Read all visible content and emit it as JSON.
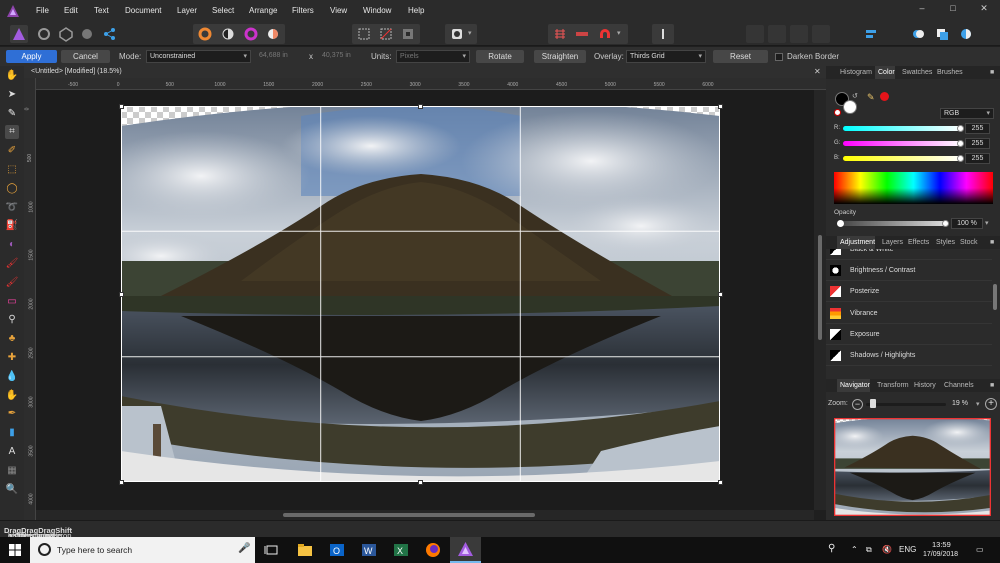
{
  "menu": {
    "items": [
      "File",
      "Edit",
      "Text",
      "Document",
      "Layer",
      "Select",
      "Arrange",
      "Filters",
      "View",
      "Window",
      "Help"
    ],
    "window_controls": {
      "minimize": "–",
      "maximize": "□",
      "close": "✕"
    }
  },
  "context": {
    "apply": "Apply",
    "cancel": "Cancel",
    "mode_label": "Mode:",
    "mode_value": "Unconstrained",
    "width": "64,688 in",
    "x_sep": "x",
    "height": "40,375 in",
    "units_label": "Units:",
    "units_value": "Pixels",
    "rotate": "Rotate",
    "straighten": "Straighten",
    "overlay_label": "Overlay:",
    "overlay_value": "Thirds Grid",
    "reset": "Reset",
    "darken_border": "Darken Border"
  },
  "document": {
    "tab_title": "<Untitled> [Modified] (18.5%)",
    "hruler": [
      "-500",
      "0",
      "500",
      "1000",
      "1500",
      "2000",
      "2500",
      "3000",
      "3500",
      "4000",
      "4500",
      "5000",
      "5500",
      "6000"
    ],
    "vruler": [
      "0",
      "500",
      "1000",
      "1500",
      "2000",
      "2500",
      "3000",
      "3500",
      "4000"
    ]
  },
  "panel_top": {
    "tabs": [
      "Histogram",
      "Color",
      "Swatches",
      "Brushes"
    ],
    "active_tab": "Color",
    "model": "RGB",
    "r_label": "R:",
    "r_value": "255",
    "g_label": "G:",
    "g_value": "255",
    "b_label": "B:",
    "b_value": "255",
    "opacity_label": "Opacity",
    "opacity_value": "100 %",
    "opacity_fraction": 1.0
  },
  "panel_mid": {
    "tabs": [
      "Adjustment",
      "Layers",
      "Effects",
      "Styles",
      "Stock"
    ],
    "active_tab": "Adjustment",
    "items": [
      "Black & White",
      "Brightness / Contrast",
      "Posterize",
      "Vibrance",
      "Exposure",
      "Shadows / Highlights"
    ]
  },
  "panel_nav": {
    "tabs": [
      "Navigator",
      "Transform",
      "History",
      "Channels"
    ],
    "active_tab": "Navigator",
    "zoom_label": "Zoom:",
    "zoom_value": "19 %",
    "zoom_fraction": 0.05
  },
  "status_bar": {
    "parts": [
      {
        "t": "Drag",
        "b": true
      },
      {
        "t": " handles to set crop size. ",
        "b": false
      },
      {
        "t": "Drag",
        "b": true
      },
      {
        "t": " inside to move crop. ",
        "b": false
      },
      {
        "t": "Drag",
        "b": true
      },
      {
        "t": " outside to rotate canvas. [O] to cycle overlay. ",
        "b": false
      },
      {
        "t": "Shift",
        "b": true
      },
      {
        "t": "+[O] to cycle orientation.",
        "b": false
      }
    ]
  },
  "taskbar": {
    "search_placeholder": "Type here to search",
    "language": "ENG",
    "time": "13:59",
    "date": "17/09/2018"
  },
  "colors": {
    "menubar": "#2b2b2b",
    "accent_blue": "#2f6fd6",
    "red_swatch": "#e5141a",
    "taskbar": "#101010"
  }
}
